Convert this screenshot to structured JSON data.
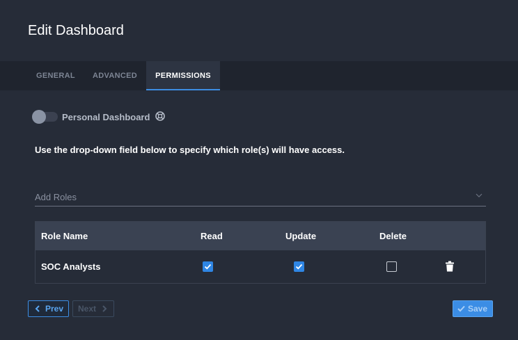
{
  "dialog": {
    "title": "Edit Dashboard"
  },
  "tabs": [
    {
      "label": "GENERAL",
      "active": false
    },
    {
      "label": "ADVANCED",
      "active": false
    },
    {
      "label": "PERMISSIONS",
      "active": true
    }
  ],
  "personal_dashboard": {
    "label": "Personal Dashboard",
    "enabled": false
  },
  "instructions": "Use the drop-down field below to specify which role(s) will have access.",
  "roles_field": {
    "placeholder": "Add Roles",
    "value": ""
  },
  "table": {
    "headers": {
      "role_name": "Role Name",
      "read": "Read",
      "update": "Update",
      "delete": "Delete"
    },
    "rows": [
      {
        "role_name": "SOC Analysts",
        "read": true,
        "update": true,
        "delete": false
      }
    ]
  },
  "buttons": {
    "prev": "Prev",
    "next": "Next",
    "save": "Save"
  },
  "colors": {
    "accent": "#3d8ee4",
    "background": "#262c38",
    "table_header": "#3a4252"
  },
  "icons": [
    "help-icon",
    "chevron-down-icon",
    "checkmark-icon",
    "trash-icon",
    "chevron-left-icon",
    "chevron-right-icon"
  ]
}
